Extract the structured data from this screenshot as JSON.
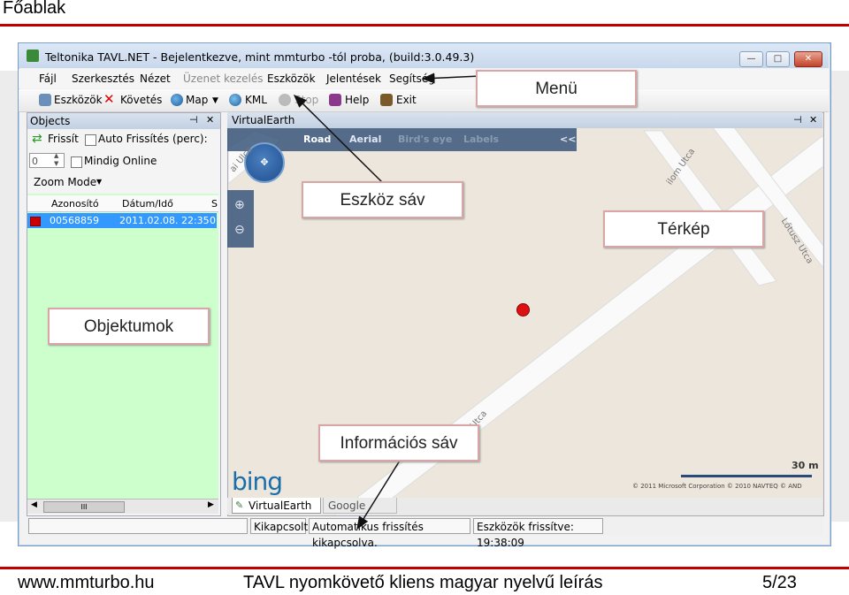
{
  "slide": {
    "title": "Főablak",
    "footer_left": "www.mmturbo.hu",
    "footer_center": "TAVL nyomkövető kliens magyar nyelvű leírás",
    "footer_right": "5/23"
  },
  "window": {
    "title": "Teltonika TAVL.NET - Bejelentkezve, mint mmturbo -tól proba,  (build:3.0.49.3)",
    "btn_min": "—",
    "btn_max": "□",
    "btn_close": "✕"
  },
  "menu": {
    "items": [
      {
        "label": "Fájl",
        "enabled": true
      },
      {
        "label": "Szerkesztés",
        "enabled": true
      },
      {
        "label": "Nézet",
        "enabled": true
      },
      {
        "label": "Üzenet kezelés",
        "enabled": false
      },
      {
        "label": "Eszközök",
        "enabled": true
      },
      {
        "label": "Jelentések",
        "enabled": true
      },
      {
        "label": "Segítség",
        "enabled": true
      }
    ]
  },
  "toolbar": {
    "eszkozok": "Eszközök",
    "kovetes": "Követés",
    "map": "Map",
    "kml": "KML",
    "stop": "Stop",
    "help": "Help",
    "exit": "Exit"
  },
  "objects_panel": {
    "title": "Objects",
    "pin": "⊣",
    "close": "✕",
    "refresh_label": "Frissít",
    "auto_refresh_label": "Auto Frissítés (perc):",
    "spinner_value": "0",
    "always_online_label": "Mindig Online",
    "zoom_mode_label": "Zoom Mode",
    "columns": [
      "Azonosító",
      "Dátum/Idő",
      "S"
    ],
    "rows": [
      {
        "id": "00568859",
        "datetime": "2011.02.08. 22:35",
        "s": "0",
        "status_color": "#cc0000"
      }
    ],
    "hscroll_thumb": "III"
  },
  "map_panel": {
    "title": "VirtualEarth",
    "nav_items": [
      "Road",
      "Aerial",
      "Bird's eye",
      "Labels"
    ],
    "nav_collapse": "<<",
    "street_labels": [
      "ilom Utca",
      "Lőtusz Utca",
      "Utca",
      "ai Ulca"
    ],
    "scale": "30 m",
    "copyright": "© 2011 Microsoft Corporation   © 2010 NAVTEQ   © AND",
    "logo": "bing",
    "tabs": [
      "VirtualEarth",
      "Google Maps"
    ],
    "marker_color": "#dd1111"
  },
  "statusbar": {
    "cells": [
      "",
      "Kikapcsolt",
      "Automatikus frissítés kikapcsolva.",
      "Eszközök frissítve: 19:38:09"
    ]
  },
  "callouts": {
    "menu": "Menü",
    "toolbar": "Eszköz sáv",
    "map": "Térkép",
    "objects": "Objektumok",
    "info": "Információs sáv"
  },
  "colors": {
    "accent_red": "#c00000",
    "selection_blue": "#3399ff",
    "list_bg": "#ccffcc",
    "map_bg": "#ece6dc"
  }
}
